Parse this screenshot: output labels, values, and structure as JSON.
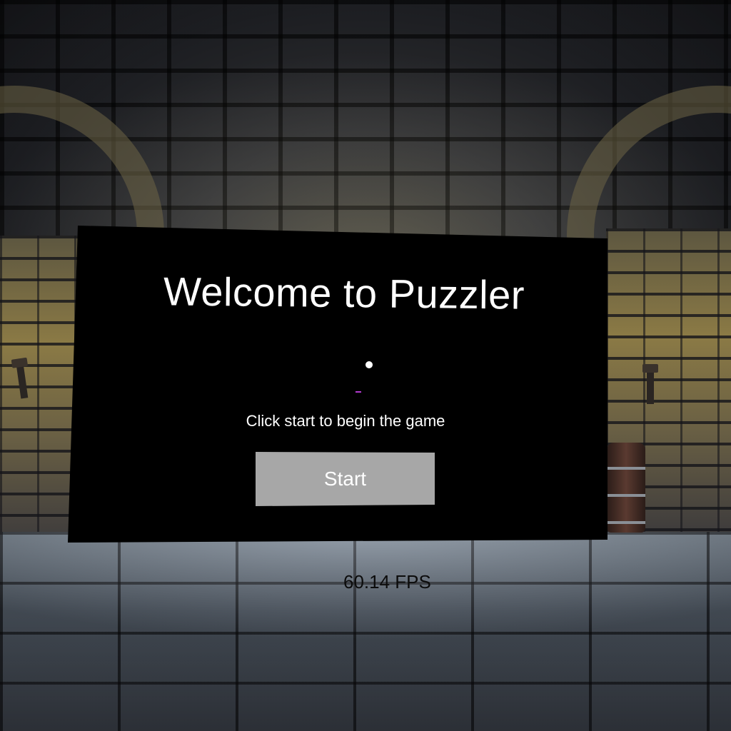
{
  "menu": {
    "title": "Welcome to Puzzler",
    "instruction": "Click start to begin the game",
    "start_label": "Start"
  },
  "hud": {
    "fps_text": "60.14 FPS"
  },
  "colors": {
    "panel_background": "#000000",
    "button_background": "#a7a7a7",
    "text": "#ffffff",
    "caret_accent": "#b23ad0"
  }
}
